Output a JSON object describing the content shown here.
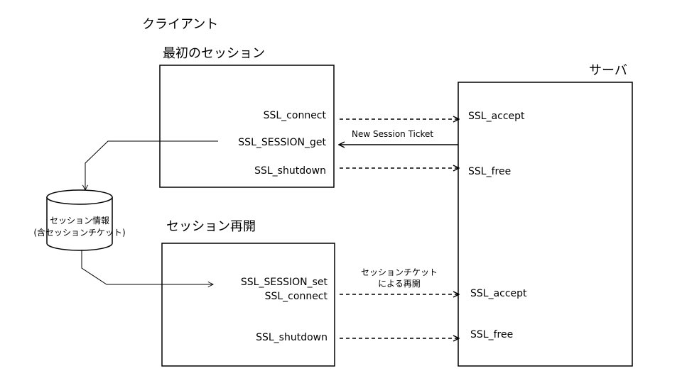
{
  "client": {
    "title": "クライアント",
    "first_session": {
      "title": "最初のセッション",
      "calls": [
        "SSL_connect",
        "SSL_SESSION_get",
        "SSL_shutdown"
      ]
    },
    "resumed_session": {
      "title": "セッション再開",
      "calls": [
        "SSL_SESSION_set",
        "SSL_connect",
        "SSL_shutdown"
      ]
    }
  },
  "storage": {
    "line1": "セッション情報",
    "line2": "(含セッションチケット)"
  },
  "server": {
    "title": "サーバ",
    "calls": [
      "SSL_accept",
      "SSL_free",
      "SSL_accept",
      "SSL_free"
    ]
  },
  "messages": {
    "new_ticket": "New Session Ticket",
    "resume_line1": "セッションチケット",
    "resume_line2": "による再開"
  }
}
